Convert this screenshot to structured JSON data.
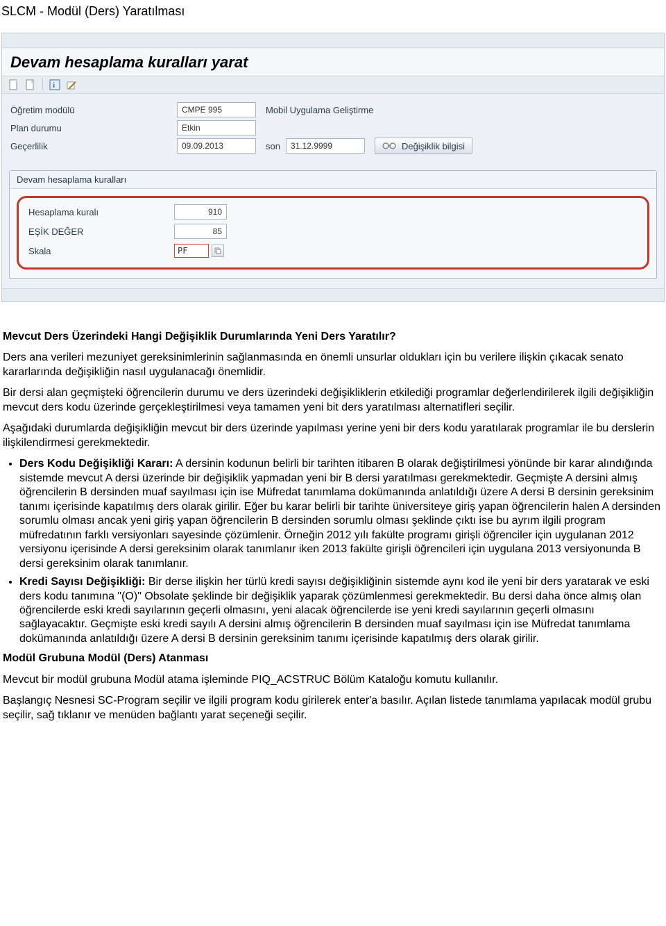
{
  "doc": {
    "title_top": "SLCM - Modül (Ders) Yaratılması",
    "h3_1": "Mevcut Ders Üzerindeki Hangi Değişiklik Durumlarında Yeni Ders Yaratılır?",
    "p1": "Ders ana verileri mezuniyet gereksinimlerinin sağlanmasında en önemli unsurlar oldukları için bu verilere ilişkin çıkacak senato kararlarında değişikliğin nasıl uygulanacağı önemlidir.",
    "p2": "Bir dersi alan geçmişteki öğrencilerin durumu ve ders üzerindeki değişikliklerin etkilediği programlar değerlendirilerek ilgili değişikliğin mevcut ders kodu üzerinde gerçekleştirilmesi veya tamamen yeni bit ders yaratılması alternatifleri seçilir.",
    "p3": "Aşağıdaki durumlarda değişikliğin mevcut bir ders üzerinde yapılması yerine yeni bir ders kodu yaratılarak programlar ile bu derslerin ilişkilendirmesi gerekmektedir.",
    "li1_label": "Ders Kodu Değişikliği Kararı:",
    "li1_text": " A dersinin kodunun belirli bir tarihten itibaren B olarak değiştirilmesi yönünde bir karar alındığında sistemde mevcut A dersi üzerinde bir değişiklik yapmadan yeni bir B dersi yaratılması gerekmektedir. Geçmişte A dersini almış öğrencilerin B dersinden muaf sayılması için ise Müfredat tanımlama dokümanında anlatıldığı üzere A dersi B dersinin gereksinim tanımı içerisinde kapatılmış ders olarak girilir. Eğer bu karar belirli bir tarihte üniversiteye giriş yapan öğrencilerin halen A dersinden sorumlu olması ancak yeni giriş yapan öğrencilerin B dersinden sorumlu olması şeklinde çıktı ise bu ayrım ilgili program müfredatının farklı versiyonları sayesinde çözümlenir. Örneğin 2012 yılı fakülte programı girişli öğrenciler için uygulanan 2012 versiyonu içerisinde A dersi gereksinim olarak tanımlanır iken 2013 fakülte girişli öğrencileri için uygulana 2013 versiyonunda B dersi gereksinim olarak tanımlanır.",
    "li2_label": "Kredi Sayısı Değişikliği:",
    "li2_text": " Bir derse ilişkin her türlü kredi sayısı değişikliğinin sistemde aynı kod ile yeni bir ders yaratarak ve eski ders kodu tanımına \"(O)\" Obsolate şeklinde bir değişiklik yaparak çözümlenmesi gerekmektedir. Bu dersi daha önce almış olan öğrencilerde eski kredi sayılarının geçerli olmasını, yeni alacak öğrencilerde ise yeni kredi sayılarının geçerli olmasını sağlayacaktır. Geçmişte eski kredi sayılı A dersini almış öğrencilerin B dersinden muaf sayılması için ise Müfredat tanımlama dokümanında anlatıldığı üzere A dersi B dersinin gereksinim tanımı içerisinde kapatılmış ders olarak girilir.",
    "h3_2": "Modül Grubuna Modül (Ders) Atanması",
    "p4": "Mevcut bir modül grubuna Modül atama işleminde PIQ_ACSTRUC Bölüm Kataloğu komutu kullanılır.",
    "p5": "Başlangıç Nesnesi SC-Program seçilir ve ilgili program kodu girilerek enter'a basılır. Açılan listede tanımlama yapılacak modül grubu seçilir, sağ tıklanır ve menüden bağlantı yarat seçeneği seçilir."
  },
  "sap": {
    "window_title": "Devam hesaplama kuralları yarat",
    "labels": {
      "module": "Öğretim modülü",
      "plan": "Plan durumu",
      "valid": "Geçerlilik",
      "end": "son",
      "section": "Devam hesaplama kuralları",
      "rule": "Hesaplama kuralı",
      "threshold": "EŞİK DEĞER",
      "scale": "Skala"
    },
    "values": {
      "module_code": "CMPE 995",
      "module_desc": "Mobil Uygulama Geliştirme",
      "plan_status": "Etkin",
      "valid_from": "09.09.2013",
      "valid_to": "31.12.9999",
      "rule": "910",
      "threshold": "85",
      "scale": "PF"
    },
    "change_info_btn": "Değişiklik bilgisi"
  }
}
